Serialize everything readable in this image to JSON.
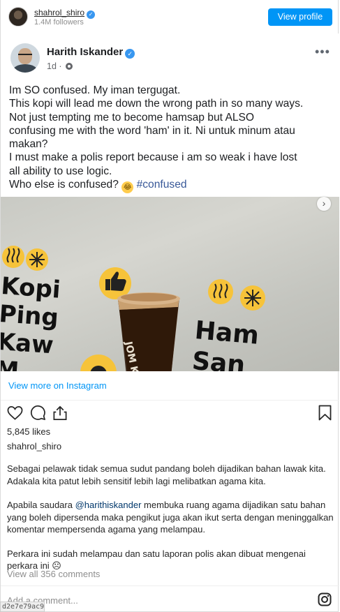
{
  "header": {
    "username": "shahrol_shiro",
    "followers": "1.4M followers",
    "view_profile": "View profile"
  },
  "fb_post": {
    "author": "Harith Iskander",
    "time": "1d ·",
    "more": "•••",
    "lines": [
      "Im SO confused. My iman tergugat.",
      "This kopi will lead me down the wrong path in so many ways.",
      "Not just tempting me to become hamsap but ALSO",
      "confusing me with the word 'ham' in it. Ni untuk minum atau",
      "makan?",
      "I must make a polis report because i am so weak i have lost",
      "all ability to use logic."
    ],
    "last_line": "Who else is confused?",
    "hashtag": "#confused"
  },
  "photo": {
    "words_left": [
      "Kopi",
      "Ping",
      "Kaw",
      "M"
    ],
    "words_right": [
      "Ham",
      "San"
    ],
    "cup_brand": "JOM K"
  },
  "view_more": "View more on Instagram",
  "likes": "5,845 likes",
  "caption": {
    "username": "shahrol_shiro",
    "p1": "Sebagai pelawak tidak semua sudut pandang boleh dijadikan bahan lawak kita. Adakala kita patut lebih sensitif lebih lagi melibatkan agama kita.",
    "p2_before": "Apabila saudara ",
    "mention": "@harithiskander",
    "p2_after": " membuka ruang agama dijadikan satu bahan yang boleh dipersenda maka pengikut juga akan ikut serta dengan meninggalkan komentar mempersenda agama yang melampau.",
    "p3": "Perkara ini sudah melampau dan satu laporan polis akan dibuat mengenai perkara ini ☹"
  },
  "view_all": "View all 356 comments",
  "comment_placeholder": "Add a comment...",
  "post_id": "d2e7e79ac9",
  "colors": {
    "accent": "#0095f6",
    "fb_link": "#385898",
    "verified": "#3897f0"
  },
  "icons": [
    "verified-badge-icon",
    "gear-icon",
    "more-icon",
    "next-arrow-icon",
    "heart-icon",
    "comment-icon",
    "share-icon",
    "bookmark-icon",
    "instagram-icon"
  ]
}
